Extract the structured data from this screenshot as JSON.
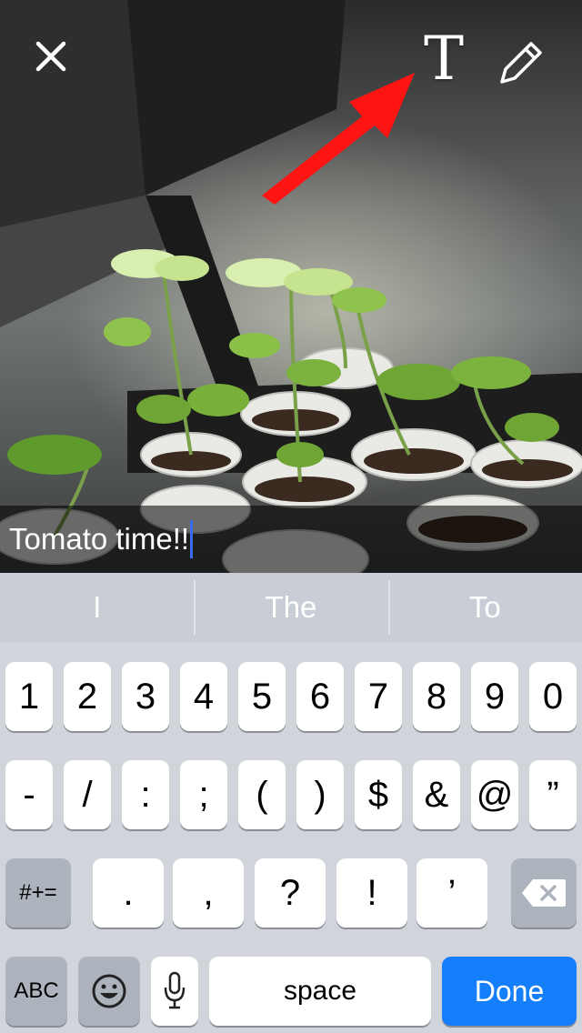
{
  "topbar": {
    "close_icon": "close-icon",
    "text_tool_glyph": "T",
    "pencil_icon": "pencil-icon"
  },
  "caption": {
    "text": "Tomato time!!"
  },
  "annotation": {
    "arrow_color": "#ff0000"
  },
  "suggestions": [
    "I",
    "The",
    "To"
  ],
  "keyboard": {
    "row1": [
      "1",
      "2",
      "3",
      "4",
      "5",
      "6",
      "7",
      "8",
      "9",
      "0"
    ],
    "row2": [
      "-",
      "/",
      ":",
      ";",
      "(",
      ")",
      "$",
      "&",
      "@",
      "”"
    ],
    "mode_key": "#+=",
    "row3": [
      ".",
      ",",
      "?",
      "!",
      "’"
    ],
    "delete_icon": "backspace-icon",
    "abc_key": "ABC",
    "emoji_icon": "emoji-icon",
    "mic_icon": "microphone-icon",
    "space_label": "space",
    "done_label": "Done",
    "accent": "#147efb"
  }
}
